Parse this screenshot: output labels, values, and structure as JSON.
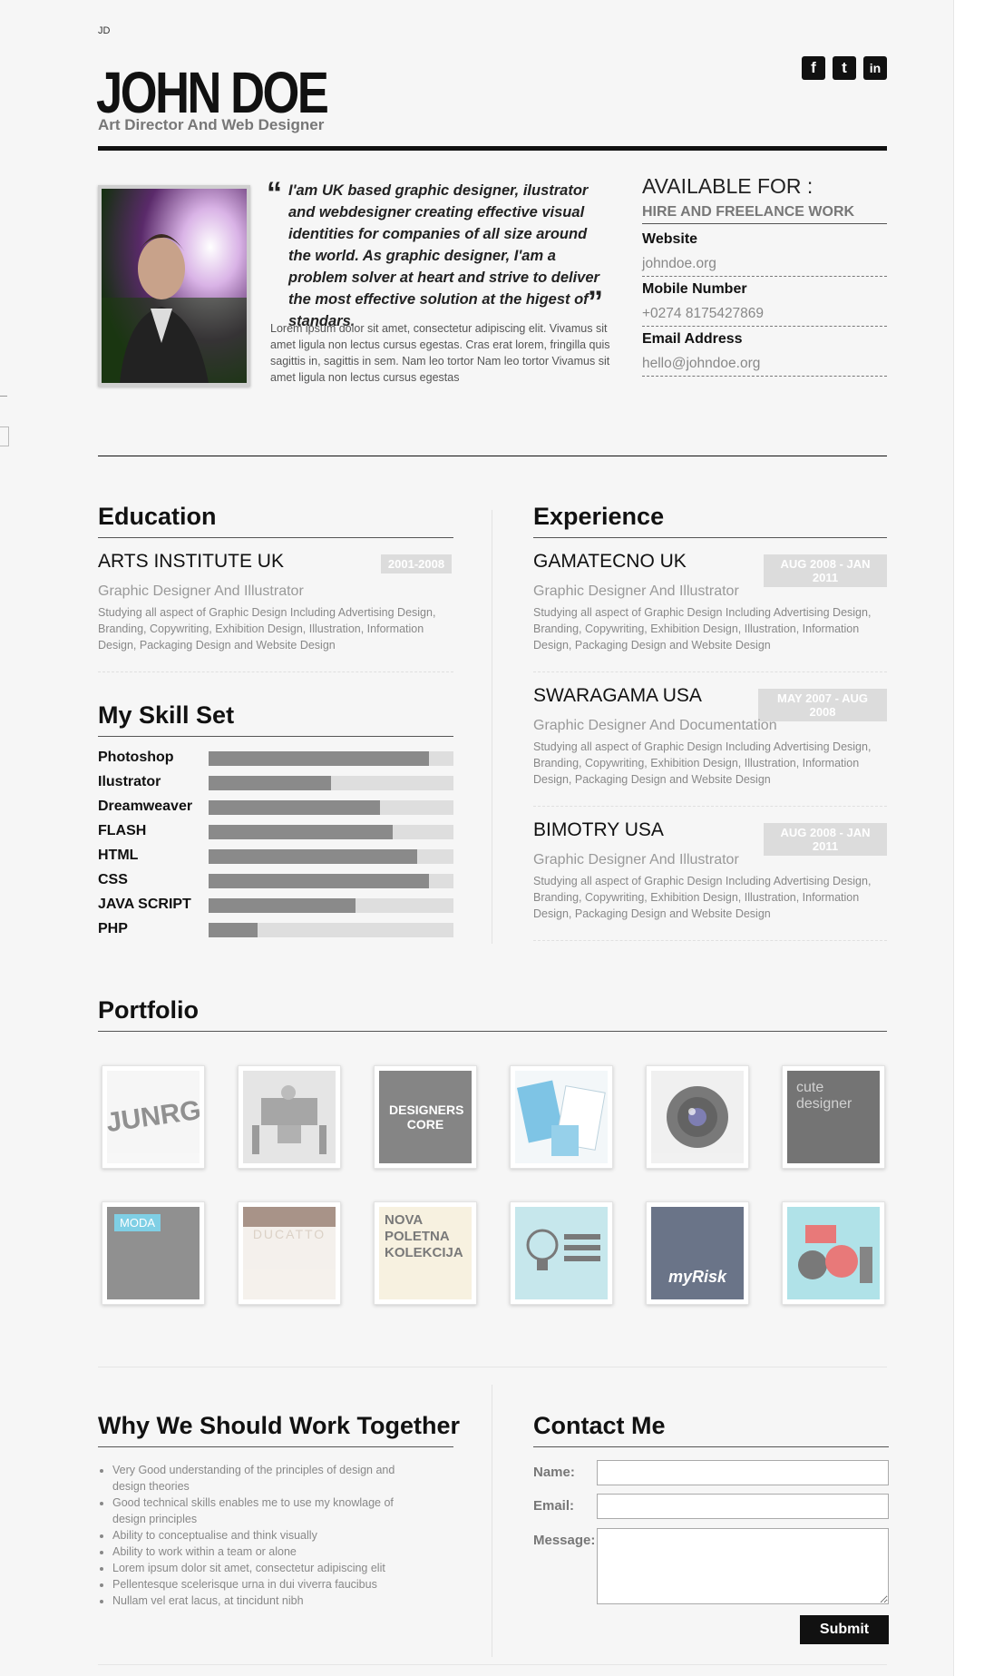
{
  "header": {
    "initials": "JD",
    "name": "JOHN DOE",
    "role": "Art Director And Web Designer",
    "social": [
      {
        "icon": "facebook-icon",
        "glyph": "f"
      },
      {
        "icon": "twitter-icon",
        "glyph": "t"
      },
      {
        "icon": "linkedin-icon",
        "glyph": "in"
      }
    ]
  },
  "intro": {
    "quote": "I'am UK based graphic designer, ilustrator and webdesigner creating effective visual identities for companies of all size around the world. As graphic designer, I'am a problem solver at heart and strive to deliver the most effective solution at the higest of standars.",
    "open_quote": "“",
    "close_quote": "”",
    "lorem": "Lorem ipsum dolor sit amet, consectetur adipiscing elit. Vivamus sit amet ligula non lectus cursus egestas. Cras erat lorem, fringilla quis sagittis in, sagittis in sem. Nam leo tortor Nam leo tortor Vivamus sit amet ligula non lectus cursus egestas"
  },
  "contact_info": {
    "available_title": "AVAILABLE FOR :",
    "available_value": "HIRE AND FREELANCE WORK",
    "website_label": "Website",
    "website_value": "johndoe.org",
    "mobile_label": "Mobile Number",
    "mobile_value": "+0274 8175427869",
    "email_label": "Email Address",
    "email_value": "hello@johndoe.org"
  },
  "education": {
    "title": "Education",
    "items": [
      {
        "title": "ARTS INSTITUTE UK",
        "date": "2001-2008",
        "subtitle": "Graphic Designer And Illustrator",
        "desc": "Studying all aspect of Graphic Design Including Advertising Design, Branding, Copywriting, Exhibition Design, Illustration, Information Design, Packaging Design and Website Design"
      }
    ]
  },
  "skills": {
    "title": "My Skill Set",
    "items": [
      {
        "name": "Photoshop",
        "level": 0.9
      },
      {
        "name": "Ilustrator",
        "level": 0.5
      },
      {
        "name": "Dreamweaver",
        "level": 0.7
      },
      {
        "name": "FLASH",
        "level": 0.75
      },
      {
        "name": "HTML",
        "level": 0.85
      },
      {
        "name": "CSS",
        "level": 0.9
      },
      {
        "name": "JAVA SCRIPT",
        "level": 0.6
      },
      {
        "name": "PHP",
        "level": 0.2
      }
    ]
  },
  "experience": {
    "title": "Experience",
    "items": [
      {
        "title": "GAMATECNO UK",
        "date": "AUG 2008 - JAN 2011",
        "subtitle": "Graphic Designer And Illustrator",
        "desc": "Studying all aspect of Graphic Design Including Advertising Design, Branding, Copywriting, Exhibition Design, Illustration, Information Design, Packaging Design and Website Design"
      },
      {
        "title": "SWARAGAMA USA",
        "date": "MAY 2007 - AUG 2008",
        "subtitle": "Graphic Designer And Documentation",
        "desc": "Studying all aspect of Graphic Design Including Advertising Design, Branding, Copywriting, Exhibition Design, Illustration, Information Design, Packaging Design and Website Design"
      },
      {
        "title": "BIMOTRY USA",
        "date": "AUG 2008 - JAN 2011",
        "subtitle": "Graphic Designer And Illustrator",
        "desc": "Studying all aspect of Graphic Design Including Advertising Design, Branding, Copywriting, Exhibition Design, Illustration, Information Design, Packaging Design and Website Design"
      }
    ]
  },
  "portfolio": {
    "title": "Portfolio",
    "row1": [
      {
        "name": "portfolio-item-typography",
        "caption": "JUNRG"
      },
      {
        "name": "portfolio-item-robot",
        "caption": ""
      },
      {
        "name": "portfolio-item-designers-core",
        "caption": "DESIGNERS CORE"
      },
      {
        "name": "portfolio-item-business-cards",
        "caption": ""
      },
      {
        "name": "portfolio-item-lens",
        "caption": ""
      },
      {
        "name": "portfolio-item-cute-designer",
        "caption": "cute designer"
      }
    ],
    "row2": [
      {
        "name": "portfolio-item-moda",
        "caption": "MODA"
      },
      {
        "name": "portfolio-item-ducatto",
        "caption": "DUCATTO"
      },
      {
        "name": "portfolio-item-nova-poletna",
        "caption": "NOVA POLETNA KOLEKCIJA"
      },
      {
        "name": "portfolio-item-lightbulb",
        "caption": ""
      },
      {
        "name": "portfolio-item-myrisk",
        "caption": "myRisk"
      },
      {
        "name": "portfolio-item-monsters",
        "caption": ""
      }
    ]
  },
  "why": {
    "title": "Why We Should Work Together",
    "items": [
      "Very Good understanding of the principles of design and design theories",
      "Good technical skills enables me to use my knowlage of design principles",
      "Ability to conceptualise and think visually",
      "Ability to work within a team or alone",
      "Lorem ipsum dolor sit amet, consectetur adipiscing elit",
      "Pellentesque scelerisque urna in dui viverra faucibus",
      "Nullam vel erat lacus, at tincidunt nibh"
    ]
  },
  "contact_form": {
    "title": "Contact Me",
    "name_label": "Name:",
    "email_label": "Email:",
    "message_label": "Message:",
    "submit_label": "Submit"
  },
  "colors": {
    "accent": "#111111",
    "badge": "#dcdcdc",
    "skill_fill": "#8a8a8a",
    "skill_track": "#dedede"
  }
}
